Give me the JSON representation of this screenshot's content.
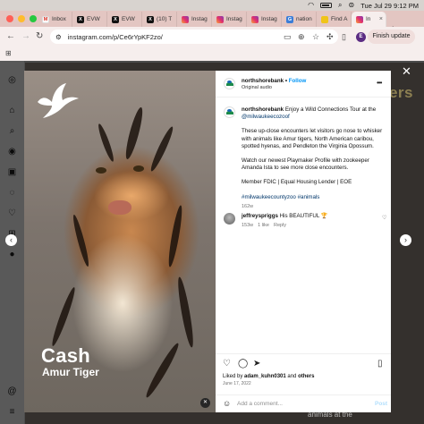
{
  "menubar": {
    "datetime": "Tue Jul 29  9:12 PM"
  },
  "tabs": [
    {
      "label": "Inbox",
      "icon": "gmail-icon",
      "favclass": "fav-gmail",
      "glyph": "M"
    },
    {
      "label": "EVW",
      "icon": "x-icon",
      "favclass": "fav-x",
      "glyph": "X"
    },
    {
      "label": "EVW",
      "icon": "x-icon",
      "favclass": "fav-x",
      "glyph": "X"
    },
    {
      "label": "(10) T",
      "icon": "x-icon",
      "favclass": "fav-x",
      "glyph": "X"
    },
    {
      "label": "Instag",
      "icon": "instagram-icon",
      "favclass": "fav-ig",
      "glyph": ""
    },
    {
      "label": "Instag",
      "icon": "instagram-icon",
      "favclass": "fav-ig",
      "glyph": ""
    },
    {
      "label": "Instag",
      "icon": "instagram-icon",
      "favclass": "fav-ig",
      "glyph": ""
    },
    {
      "label": "nation",
      "icon": "globe-icon",
      "favclass": "fav-nat",
      "glyph": "G"
    },
    {
      "label": "Find A",
      "icon": "find-icon",
      "favclass": "fav-find",
      "glyph": ""
    },
    {
      "label": "In",
      "icon": "instagram-icon",
      "favclass": "fav-ig",
      "glyph": "",
      "active": true
    }
  ],
  "address": {
    "url": "instagram.com/p/Ce6rYpKF2zo/"
  },
  "toolbar": {
    "finish_update": "Finish update",
    "profile_initial": "E"
  },
  "background": {
    "banner_text": "#BOLThankers",
    "bottom_text": "animals at the"
  },
  "media": {
    "animal_name": "Cash",
    "species": "Amur Tiger"
  },
  "post": {
    "username": "northshorebank",
    "follow_sep": " • ",
    "follow_label": "Follow",
    "audio": "Original audio",
    "caption_user": "northshorebank",
    "caption_p1": "Enjoy a Wild Connections Tour at the",
    "caption_mention": "@milwaukeecozoof",
    "caption_p2": "These up-close encounters let visitors go nose to whisker with animals like Amur tigers, North American caribou, spotted hyenas, and Pendleton the Virginia Opossum.",
    "caption_p3": "Watch our newest Playmaker Profile with zookeeper Amanda Ista to see more close encounters.",
    "caption_p4": "Member FDIC | Equal Housing Lender | EOE",
    "hashtags": "#milwaukeecountyzoo #animals",
    "caption_age": "162w",
    "comment_user": "jeffreyspriggs",
    "comment_text": " His BEAUTIFUL 🏆",
    "comment_age": "153w",
    "comment_likes": "1 like",
    "comment_reply": "Reply",
    "liked_prefix": "Liked by ",
    "liked_user": "adam_kuhn0301",
    "liked_and": " and ",
    "liked_others": "others",
    "date": "June 17, 2022",
    "add_comment_placeholder": "Add a comment...",
    "post_label": "Post"
  },
  "colors": {
    "accent_blue": "#0095f6",
    "link": "#00376b",
    "tab_strip": "#e3c6c2"
  }
}
